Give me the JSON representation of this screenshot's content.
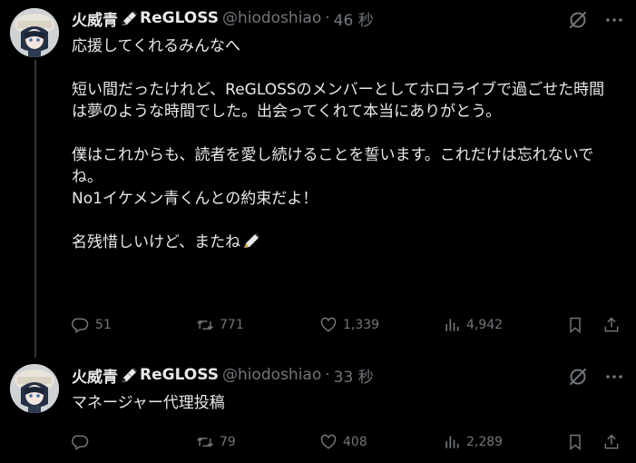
{
  "tweets": [
    {
      "name": "火威青",
      "name_suffix": "ReGLOSS",
      "handle": "@hiodoshiao",
      "time": "46 秒",
      "text": "応援してくれるみんなへ\n\n短い間だったけれど、ReGLOSSのメンバーとしてホロライブで過ごせた時間は夢のような時間でした。出会ってくれて本当にありがとう。\n\n僕はこれからも、読者を愛し続けることを誓います。これだけは忘れないでね。\nNo1イケメン青くんとの約束だよ！\n\n名残惜しいけど、またね",
      "replies": "51",
      "retweets": "771",
      "likes": "1,339",
      "views": "4,942"
    },
    {
      "name": "火威青",
      "name_suffix": "ReGLOSS",
      "handle": "@hiodoshiao",
      "time": "33 秒",
      "text": "マネージャー代理投稿",
      "replies": "",
      "retweets": "79",
      "likes": "408",
      "views": "2,289"
    }
  ],
  "icons": {
    "reply": "reply-bubble-icon",
    "retweet": "retweet-icon",
    "like": "heart-icon",
    "views": "views-bar-icon",
    "bookmark": "bookmark-icon",
    "share": "share-icon",
    "grok": "grok-icon",
    "more": "more-dots-icon",
    "pen": "pen-emoji-icon"
  },
  "colors": {
    "background": "#000000",
    "text": "#e7e9ea",
    "muted": "#71767b",
    "thread_line": "#333639"
  }
}
